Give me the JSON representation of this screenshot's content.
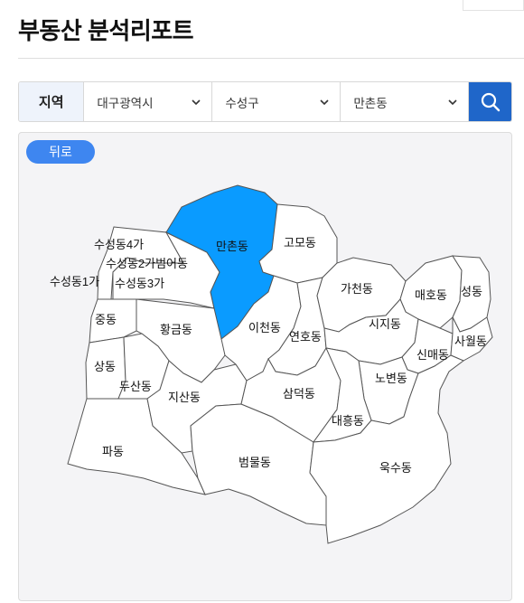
{
  "header": {
    "title": "부동산 분석리포트"
  },
  "filters": {
    "region_label": "지역",
    "city": "대구광역시",
    "district": "수성구",
    "dong": "만촌동"
  },
  "icons": {
    "search": "search-icon",
    "dropdown": "chevron-down-icon"
  },
  "colors": {
    "accent": "#1f66c9",
    "selected": "#0a9bff",
    "back_button": "#3e86f0"
  },
  "map": {
    "back_label": "뒤로",
    "selected": "만촌동",
    "labels": {
      "suseong4": "수성동4가",
      "suseong2": "수성동2가범어동",
      "suseong1": "수성동1가",
      "suseong3": "수성동3가",
      "manchon": "만촌동",
      "gomo": "고모동",
      "gacheon": "가천동",
      "maeho": "매호동",
      "seong": "성동",
      "jung": "중동",
      "hwanggeum": "황금동",
      "icheon": "이천동",
      "yeonho": "연호동",
      "siji": "시지동",
      "sinmae": "신매동",
      "sawol": "사월동",
      "sang": "상동",
      "dusan": "두산동",
      "jisan": "지산동",
      "samdeok": "삼덕동",
      "nobyeon": "노변동",
      "daeheung": "대흥동",
      "pa": "파동",
      "beommul": "범물동",
      "uksu": "욱수동"
    }
  }
}
